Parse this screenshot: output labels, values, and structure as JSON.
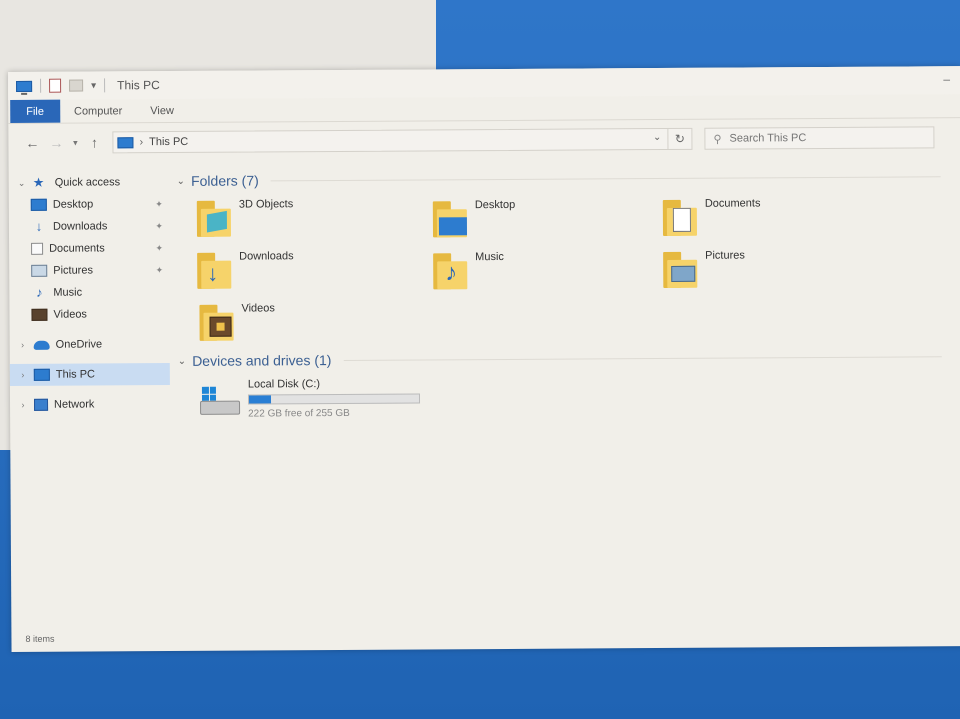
{
  "window": {
    "title": "This PC",
    "minimize_glyph": "–"
  },
  "ribbon": {
    "tabs": [
      "File",
      "Computer",
      "View"
    ]
  },
  "address": {
    "path": "This PC",
    "search_placeholder": "Search This PC"
  },
  "nav": {
    "quick_access": "Quick access",
    "quick_items": [
      {
        "label": "Desktop",
        "icon": "desktop-icon"
      },
      {
        "label": "Downloads",
        "icon": "downloads-icon"
      },
      {
        "label": "Documents",
        "icon": "documents-icon"
      },
      {
        "label": "Pictures",
        "icon": "pictures-icon"
      },
      {
        "label": "Music",
        "icon": "music-icon"
      },
      {
        "label": "Videos",
        "icon": "videos-icon"
      }
    ],
    "onedrive": "OneDrive",
    "this_pc": "This PC",
    "network": "Network"
  },
  "content": {
    "folders_header": "Folders (7)",
    "folders": [
      {
        "name": "3D Objects",
        "icon": "3d-objects-folder-icon"
      },
      {
        "name": "Desktop",
        "icon": "desktop-folder-icon"
      },
      {
        "name": "Documents",
        "icon": "documents-folder-icon"
      },
      {
        "name": "Downloads",
        "icon": "downloads-folder-icon"
      },
      {
        "name": "Music",
        "icon": "music-folder-icon"
      },
      {
        "name": "Pictures",
        "icon": "pictures-folder-icon"
      },
      {
        "name": "Videos",
        "icon": "videos-folder-icon"
      }
    ],
    "drives_header": "Devices and drives (1)",
    "drive": {
      "name": "Local Disk (C:)",
      "free_text": "222 GB free of 255 GB",
      "used_fraction": 0.13
    }
  },
  "status": {
    "items": "8 items"
  },
  "colors": {
    "accent": "#2a67b8",
    "selection": "#c9dcf2",
    "drive_bar": "#2a7fd4",
    "folder": "#f6d36a"
  }
}
